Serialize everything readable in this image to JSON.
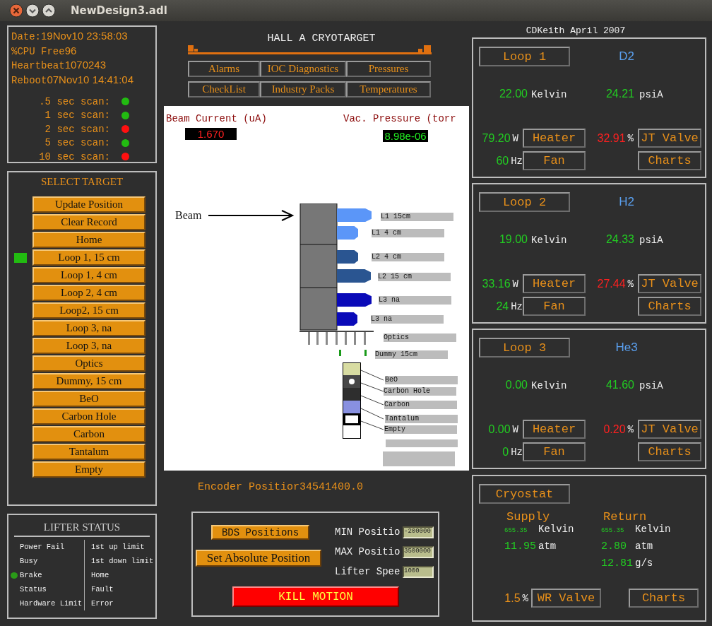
{
  "window": {
    "title": "NewDesign3.adl"
  },
  "status": {
    "lines": [
      {
        "label": "Date: ",
        "value": "19Nov10 23:58:03"
      },
      {
        "label": "%CPU Free",
        "value": "96"
      },
      {
        "label": "Heartbeat",
        "value": "1070243"
      },
      {
        "label": "Reboot",
        "value": "07Nov10 14:41:04"
      }
    ],
    "scans": [
      {
        "label": ".5 sec scan:",
        "ok": true
      },
      {
        "label": "1 sec scan:",
        "ok": true
      },
      {
        "label": "2 sec scan:",
        "ok": false
      },
      {
        "label": "5 sec scan:",
        "ok": true
      },
      {
        "label": "10 sec scan:",
        "ok": false
      }
    ]
  },
  "select_target": {
    "title": "SELECT TARGET",
    "buttons": [
      {
        "label": "Update Position",
        "selected": false
      },
      {
        "label": "Clear Record",
        "selected": false
      },
      {
        "label": "Home",
        "selected": false
      },
      {
        "label": "Loop 1, 15 cm",
        "selected": true
      },
      {
        "label": "Loop 1, 4 cm",
        "selected": false
      },
      {
        "label": "Loop 2, 4 cm",
        "selected": false
      },
      {
        "label": "Loop2, 15 cm",
        "selected": false
      },
      {
        "label": "Loop 3, na",
        "selected": false
      },
      {
        "label": "Loop 3, na",
        "selected": false
      },
      {
        "label": "Optics",
        "selected": false
      },
      {
        "label": "Dummy, 15 cm",
        "selected": false
      },
      {
        "label": "BeO",
        "selected": false
      },
      {
        "label": "Carbon Hole",
        "selected": false
      },
      {
        "label": "Carbon",
        "selected": false
      },
      {
        "label": "Tantalum",
        "selected": false
      },
      {
        "label": "Empty",
        "selected": false
      }
    ]
  },
  "lifter_status": {
    "title": "LIFTER STATUS",
    "indicators": [
      {
        "label": "Power Fail",
        "on": false
      },
      {
        "label": "Busy",
        "on": false
      },
      {
        "label": "Brake",
        "on": true
      },
      {
        "label": "Status",
        "on": false
      },
      {
        "label": "Hardware Limit",
        "on": false
      }
    ],
    "limits": [
      "1st up limit",
      "1st down limit",
      "Home",
      "Fault",
      "Error"
    ]
  },
  "header": {
    "title": "HALL A CRYOTARGET",
    "nav": [
      "Alarms",
      "IOC Diagnostics",
      "Pressures",
      "CheckList",
      "Industry Packs",
      "Temperatures"
    ]
  },
  "diagram": {
    "beam_current": {
      "label": "Beam Current (uA)",
      "value": "1.670"
    },
    "vac_pressure": {
      "label": "Vac. Pressure (torr",
      "value": "8.98e-06"
    },
    "beam_label": "Beam",
    "cells": [
      {
        "label": "L1 15cm",
        "color": "#5b96f8"
      },
      {
        "label": "L1 4 cm",
        "color": "#5b96f8"
      },
      {
        "label": "L2 4 cm",
        "color": "#2a5591"
      },
      {
        "label": "L2 15 cm",
        "color": "#2a5591"
      },
      {
        "label": "L3 na",
        "color": "#0a0ab8"
      },
      {
        "label": "L3 na",
        "color": "#0a0ab8"
      }
    ],
    "solid_targets": [
      "Optics",
      "Dummy 15cm"
    ],
    "ladder": [
      "BeO",
      "Carbon Hole",
      "Carbon",
      "Tantalum",
      "Empty"
    ]
  },
  "encoder": {
    "label": "Encoder Positior",
    "value": "34541400.0"
  },
  "motion": {
    "buttons": [
      "BDS Positions",
      "Set Absolute Position"
    ],
    "fields": [
      {
        "label": "MIN Positio",
        "value": "-200000"
      },
      {
        "label": "MAX Positio",
        "value": "3500000"
      },
      {
        "label": "Lifter Spee",
        "value": "1000"
      }
    ],
    "kill": "KILL MOTION"
  },
  "credit": "CDKeith April 2007",
  "loops": [
    {
      "button": "Loop 1",
      "gas": "D2",
      "temp": "22.00",
      "temp_unit": "Kelvin",
      "pressure": "24.21",
      "pressure_unit": "psiA",
      "heater": "79.20",
      "heater_unit": "W",
      "heater_button": "Heater",
      "valve": "32.91",
      "valve_unit": "%",
      "valve_button": "JT Valve",
      "fan": "60",
      "fan_unit": "Hz",
      "fan_button": "Fan",
      "charts_button": "Charts"
    },
    {
      "button": "Loop 2",
      "gas": "H2",
      "temp": "19.00",
      "temp_unit": "Kelvin",
      "pressure": "24.33",
      "pressure_unit": "psiA",
      "heater": "33.16",
      "heater_unit": "W",
      "heater_button": "Heater",
      "valve": "27.44",
      "valve_unit": "%",
      "valve_button": "JT Valve",
      "fan": "24",
      "fan_unit": "Hz",
      "fan_button": "Fan",
      "charts_button": "Charts"
    },
    {
      "button": "Loop 3",
      "gas": "He3",
      "temp": "0.00",
      "temp_unit": "Kelvin",
      "pressure": "41.60",
      "pressure_unit": "psiA",
      "heater": "0.00",
      "heater_unit": "W",
      "heater_button": "Heater",
      "valve": "0.20",
      "valve_unit": "%",
      "valve_button": "JT Valve",
      "fan": "0",
      "fan_unit": "Hz",
      "fan_button": "Fan",
      "charts_button": "Charts"
    }
  ],
  "cryostat": {
    "button": "Cryostat",
    "supply": {
      "title": "Supply",
      "rows": [
        {
          "value": "655.35",
          "unit": "Kelvin"
        },
        {
          "value": "11.95",
          "unit": "atm"
        }
      ]
    },
    "return": {
      "title": "Return",
      "rows": [
        {
          "value": "655.35",
          "unit": "Kelvin"
        },
        {
          "value": "2.80",
          "unit": "atm"
        },
        {
          "value": "12.81",
          "unit": "g/s"
        }
      ]
    },
    "valve": "1.5",
    "valve_unit": "%",
    "valve_button": "WR Valve",
    "charts_button": "Charts"
  }
}
